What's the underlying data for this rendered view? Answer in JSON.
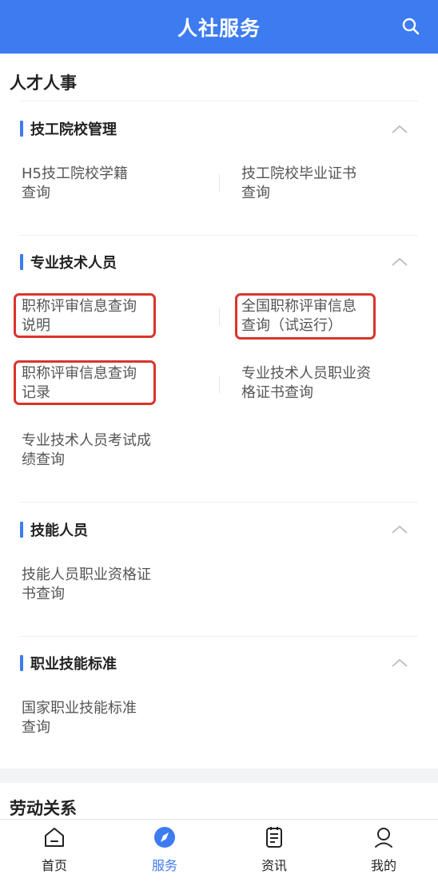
{
  "header": {
    "title": "人社服务",
    "search_icon": "search-icon"
  },
  "categories": {
    "talent": "人才人事",
    "labor": "劳动关系"
  },
  "sections": [
    {
      "title": "技工院校管理",
      "items": [
        {
          "line1": "H5技工院校学籍",
          "line2": "查询"
        },
        {
          "line1": "技工院校毕业证书",
          "line2": "查询"
        }
      ]
    },
    {
      "title": "专业技术人员",
      "items": [
        {
          "line1": "职称评审信息查询",
          "line2": "说明",
          "highlighted": true
        },
        {
          "line1": "全国职称评审信息",
          "line2": "查询（试运行）",
          "highlighted": true
        },
        {
          "line1": "职称评审信息查询",
          "line2": "记录",
          "highlighted": true
        },
        {
          "line1": "专业技术人员职业资",
          "line2": "格证书查询"
        },
        {
          "line1": "专业技术人员考试成",
          "line2": "绩查询"
        }
      ]
    },
    {
      "title": "技能人员",
      "items": [
        {
          "line1": "技能人员职业资格证",
          "line2": "书查询"
        }
      ]
    },
    {
      "title": "职业技能标准",
      "items": [
        {
          "line1": "国家职业技能标准",
          "line2": "查询"
        }
      ]
    }
  ],
  "tabbar": {
    "active": "服务",
    "tabs": [
      {
        "label": "首页",
        "icon": "home-icon"
      },
      {
        "label": "服务",
        "icon": "compass-icon"
      },
      {
        "label": "资讯",
        "icon": "news-icon"
      },
      {
        "label": "我的",
        "icon": "user-icon"
      }
    ]
  },
  "colors": {
    "accent": "#3d7cf0",
    "highlight": "#d9342b"
  }
}
